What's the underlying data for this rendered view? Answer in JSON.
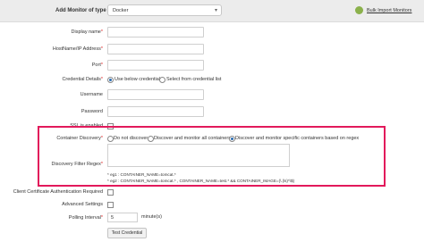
{
  "header": {
    "title": "Add Monitor of type",
    "monitor_type": "Docker",
    "bulk_import_label": "Bulk Import Monitors"
  },
  "form": {
    "display_name_label": "Display name",
    "hostname_label": "HostName/IP Address",
    "port_label": "Port",
    "credential_label": "Credential Details",
    "credential_options": [
      "Use below credential",
      "Select from credential list"
    ],
    "credential_selected": "Use below credential",
    "username_label": "Username",
    "password_label": "Password",
    "ssl_label": "SSL is enabled",
    "container_discovery_label": "Container Discovery",
    "discovery_options": [
      "Do not discover",
      "Discover and monitor all containers",
      "Discover and monitor specific containers based on regex"
    ],
    "discovery_selected": "Discover and monitor specific containers based on regex",
    "filter_regex_label": "Discovery Filter Regex",
    "hint_1": "* eg1 : CONTAINER_NAME=tomcat.*",
    "hint_2": "* eg2 : CONTAINER_NAME=tomcat.* , CONTAINER_NAME=test.* && CONTAINER_IMAGE=(\\.|\\s)*\\$)",
    "client_cert_label": "Client Certificate Authentication Required",
    "advanced_label": "Advanced Settings",
    "polling_label": "Polling Interval",
    "polling_value": "5",
    "polling_unit": "minute(s)",
    "test_button": "Test Credential",
    "required_mark": "*"
  },
  "colors": {
    "highlight_border": "#e2195b",
    "required": "#e02020",
    "radio_selected": "#2b6cb0"
  }
}
